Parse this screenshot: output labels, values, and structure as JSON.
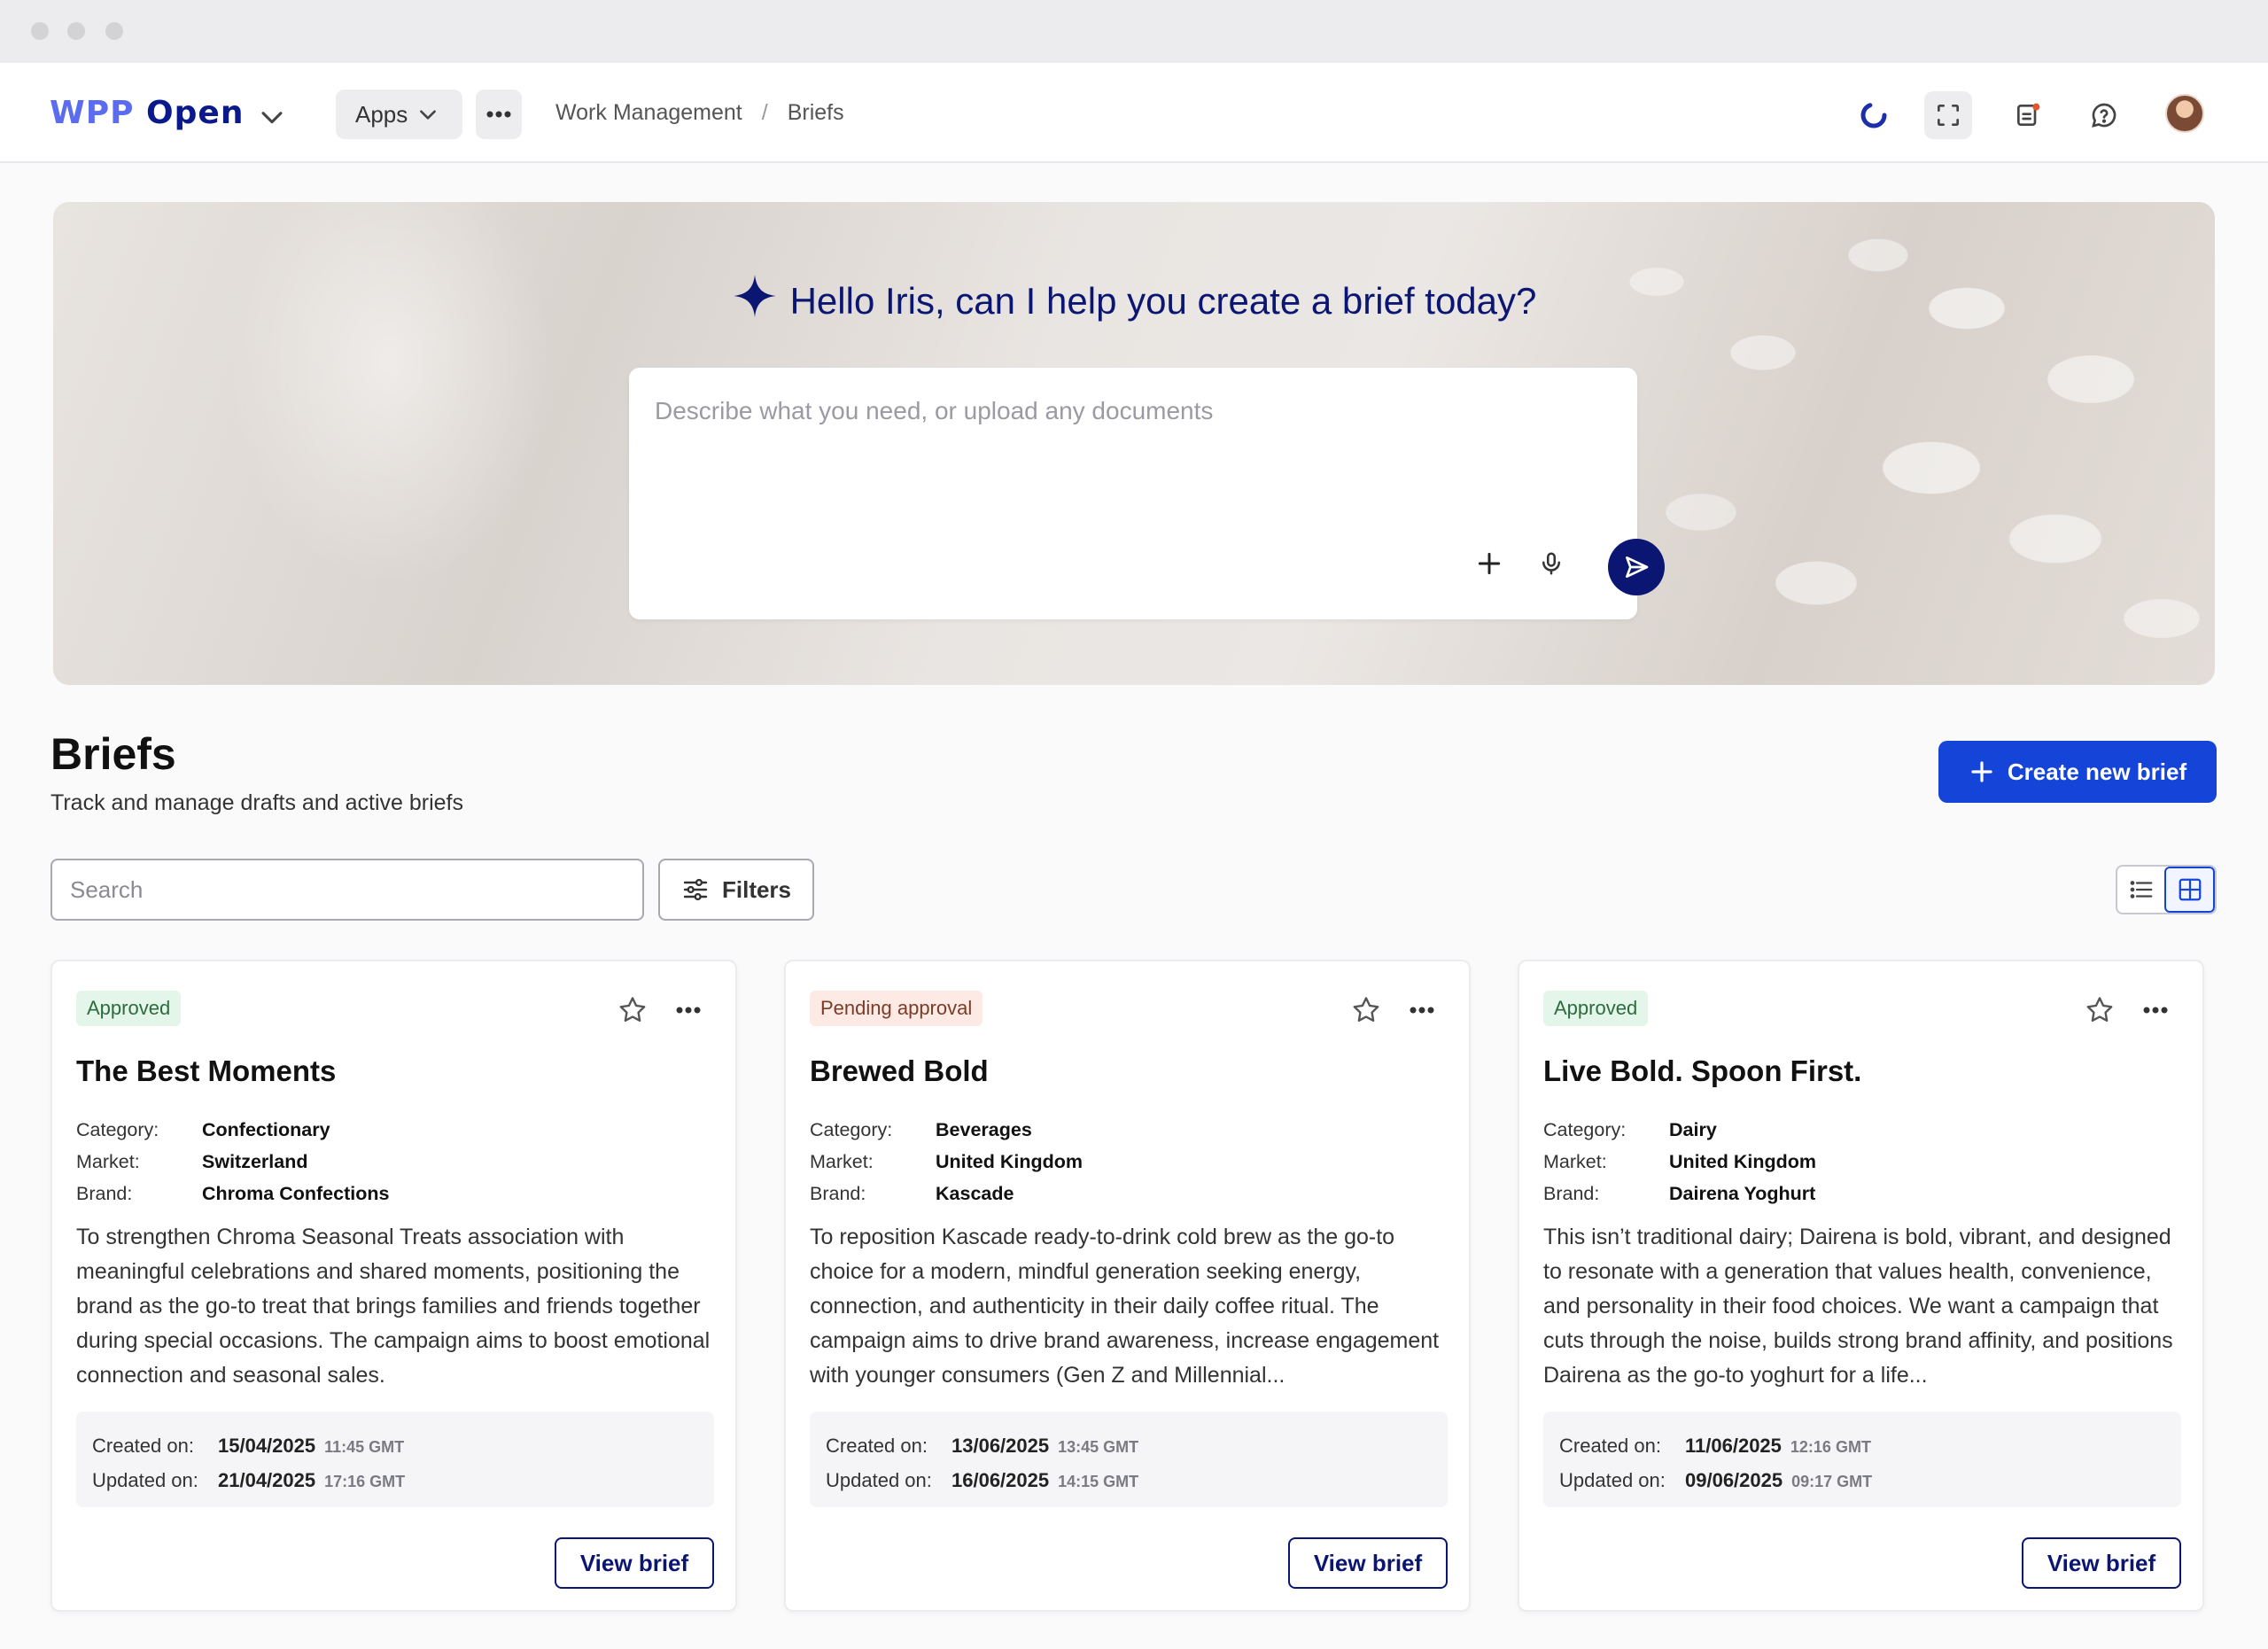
{
  "app": {
    "logo_prefix": "WPP",
    "logo_suffix": "Open",
    "apps_label": "Apps",
    "breadcrumb": [
      "Work Management",
      "Briefs"
    ],
    "breadcrumb_sep": "/"
  },
  "hero": {
    "greeting": "Hello Iris, can I help you create a brief today?",
    "prompt_placeholder": "Describe what you need, or upload any documents"
  },
  "briefs": {
    "title": "Briefs",
    "subtitle": "Track and manage drafts and active briefs",
    "create_label": "Create new brief",
    "search_placeholder": "Search",
    "filters_label": "Filters"
  },
  "labels": {
    "category": "Category:",
    "market": "Market:",
    "brand": "Brand:",
    "created_on": "Created on:",
    "updated_on": "Updated on:",
    "view_brief": "View brief"
  },
  "cards": [
    {
      "status": "Approved",
      "title": "The Best Moments",
      "category": "Confectionary",
      "market": "Switzerland",
      "brand": "Chroma Confections",
      "description": "To strengthen Chroma Seasonal Treats association with meaningful celebrations and shared moments, positioning the brand as the go-to treat that brings families and friends together during special occasions. The campaign aims to boost emotional connection and seasonal sales.",
      "created_date": "15/04/2025",
      "created_time": "11:45 GMT",
      "updated_date": "21/04/2025",
      "updated_time": "17:16 GMT"
    },
    {
      "status": "Pending approval",
      "title": "Brewed Bold",
      "category": "Beverages",
      "market": "United Kingdom",
      "brand": "Kascade",
      "description": "To reposition Kascade ready-to-drink cold brew as the go-to choice for a modern, mindful generation seeking energy, connection, and authenticity in their daily coffee ritual. The campaign aims to drive brand awareness, increase engagement with younger consumers (Gen Z and Millennial...",
      "created_date": "13/06/2025",
      "created_time": "13:45 GMT",
      "updated_date": "16/06/2025",
      "updated_time": "14:15 GMT"
    },
    {
      "status": "Approved",
      "title": "Live Bold. Spoon First.",
      "category": "Dairy",
      "market": "United Kingdom",
      "brand": "Dairena Yoghurt",
      "description": "This isn’t traditional dairy; Dairena is bold, vibrant, and designed to resonate with a generation that values health, convenience, and personality in their food choices. We want a campaign that cuts through the noise, builds strong brand affinity, and positions Dairena as the go-to yoghurt for a life...",
      "created_date": "11/06/2025",
      "created_time": "12:16 GMT",
      "updated_date": "09/06/2025",
      "updated_time": "09:17 GMT"
    }
  ],
  "colors": {
    "primary": "#1444d8",
    "navy": "#0a1672",
    "approved_bg": "#e4f6e9",
    "pending_bg": "#fdeae4"
  }
}
